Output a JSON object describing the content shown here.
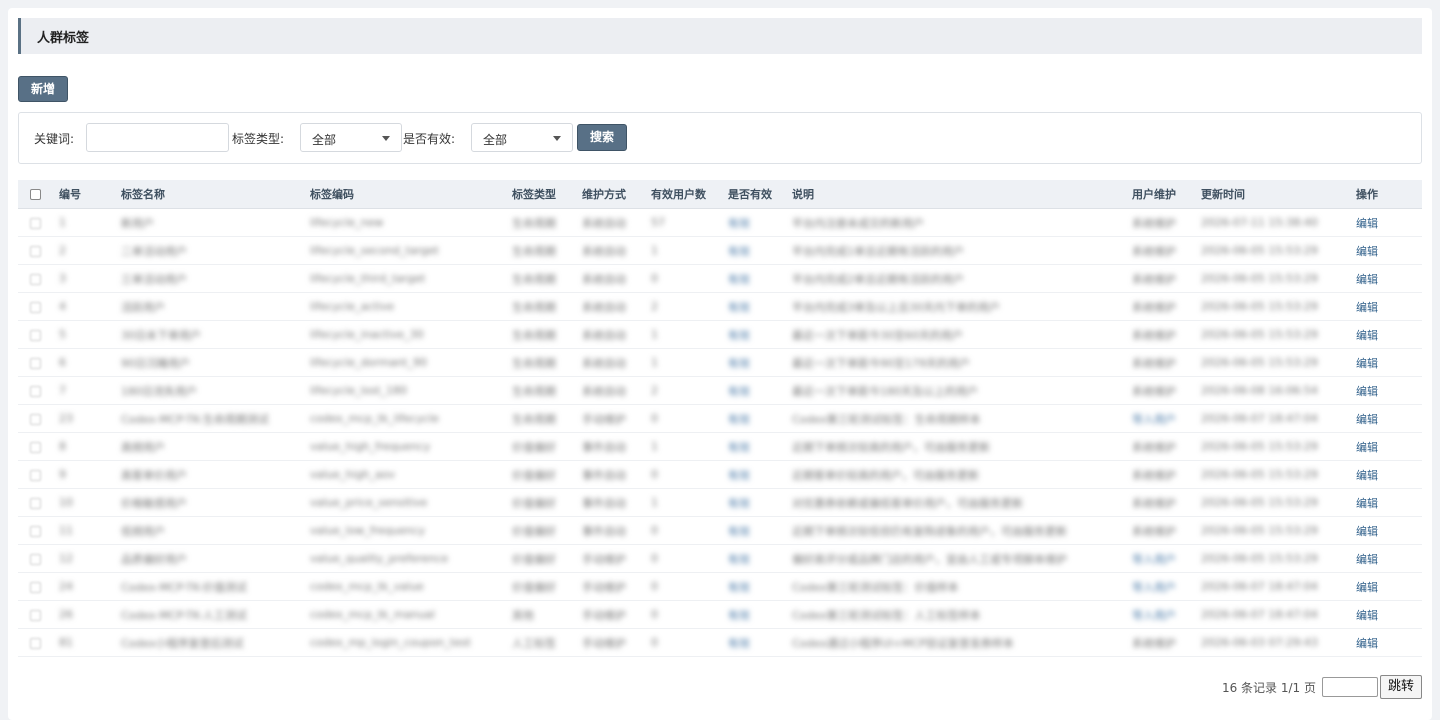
{
  "header": {
    "title": "人群标签"
  },
  "toolbar": {
    "add_label": "新增"
  },
  "search": {
    "keyword_label": "关键词:",
    "keyword_value": "",
    "type_label": "标签类型:",
    "type_value": "全部",
    "valid_label": "是否有效:",
    "valid_value": "全部",
    "search_label": "搜索"
  },
  "table": {
    "columns": [
      "编号",
      "标签名称",
      "标签编码",
      "标签类型",
      "维护方式",
      "有效用户数",
      "是否有效",
      "说明",
      "用户维护",
      "更新时间",
      "操作"
    ],
    "rows": [
      [
        "1",
        "新用户",
        "lifecycle_new",
        "生命周期",
        "系统自动",
        "57",
        "有效",
        "平台内注册未成交的新用户",
        "系统维护",
        "2026-07-11 15:38:40",
        "编辑"
      ],
      [
        "2",
        "二单活动用户",
        "lifecycle_second_target",
        "生命周期",
        "系统自动",
        "1",
        "有效",
        "平台内完成1单且近期有活跃的用户",
        "系统维护",
        "2026-06-05 15:53:29",
        "编辑"
      ],
      [
        "3",
        "三单活动用户",
        "lifecycle_third_target",
        "生命周期",
        "系统自动",
        "0",
        "有效",
        "平台内完成2单且近期有活跃的用户",
        "系统维护",
        "2026-06-05 15:53:29",
        "编辑"
      ],
      [
        "4",
        "活跃用户",
        "lifecycle_active",
        "生命周期",
        "系统自动",
        "2",
        "有效",
        "平台内完成3单及以上且30天内下单的用户",
        "系统维护",
        "2026-06-05 15:53:29",
        "编辑"
      ],
      [
        "5",
        "30日未下单用户",
        "lifecycle_inactive_30",
        "生命周期",
        "系统自动",
        "1",
        "有效",
        "最近一次下单距今30至60天的用户",
        "系统维护",
        "2026-06-05 15:53:29",
        "编辑"
      ],
      [
        "6",
        "90日沉睡用户",
        "lifecycle_dormant_90",
        "生命周期",
        "系统自动",
        "1",
        "有效",
        "最近一次下单距今90至179天的用户",
        "系统维护",
        "2026-06-05 15:53:29",
        "编辑"
      ],
      [
        "7",
        "180日流失用户",
        "lifecycle_lost_180",
        "生命周期",
        "系统自动",
        "2",
        "有效",
        "最近一次下单距今180天及以上的用户",
        "系统维护",
        "2026-06-08 16:06:54",
        "编辑"
      ],
      [
        "23",
        "Codex-MCP-TK-生命周期测试",
        "codex_mcp_tk_lifecycle",
        "生命周期",
        "手动维护",
        "0",
        "有效",
        "Codex第三轮测试标签：生命周期样本",
        "导入用户",
        "2026-06-07 18:47:04",
        "编辑"
      ],
      [
        "8",
        "高频用户",
        "value_high_frequency",
        "价值偏好",
        "事件自动",
        "1",
        "有效",
        "近期下单频次较高的用户，可由服务更新",
        "系统维护",
        "2026-06-05 15:53:29",
        "编辑"
      ],
      [
        "9",
        "高客单价用户",
        "value_high_aov",
        "价值偏好",
        "事件自动",
        "0",
        "有效",
        "近期客单价较高的用户，可由服务更新",
        "系统维护",
        "2026-06-05 15:53:29",
        "编辑"
      ],
      [
        "10",
        "价格敏感用户",
        "value_price_sensitive",
        "价值偏好",
        "事件自动",
        "1",
        "有效",
        "对优惠券依赖或偏低客单价用户，可由服务更新",
        "系统维护",
        "2026-06-05 15:53:29",
        "编辑"
      ],
      [
        "11",
        "低频用户",
        "value_low_frequency",
        "价值偏好",
        "事件自动",
        "0",
        "有效",
        "近期下单频次较低但仍有复购迹象的用户，可由服务更新",
        "系统维护",
        "2026-06-05 15:53:29",
        "编辑"
      ],
      [
        "12",
        "品质偏好用户",
        "value_quality_preference",
        "价值偏好",
        "手动维护",
        "0",
        "有效",
        "偏好高评分或品牌门店的用户，宜由人工或专项脚本维护",
        "导入用户",
        "2026-06-05 15:53:29",
        "编辑"
      ],
      [
        "24",
        "Codex-MCP-TK-价值测试",
        "codex_mcp_tk_value",
        "价值偏好",
        "手动维护",
        "0",
        "有效",
        "Codex第三轮测试标签：价值样本",
        "导入用户",
        "2026-06-07 18:47:04",
        "编辑"
      ],
      [
        "26",
        "Codex-MCP-TK-人工测试",
        "codex_mcp_tk_manual",
        "其他",
        "手动维护",
        "0",
        "有效",
        "Codex第三轮测试标签：人工标签样本",
        "导入用户",
        "2026-06-07 18:47:04",
        "编辑"
      ],
      [
        "81",
        "Codex小程序复登后测试",
        "codex_mp_login_coupon_test",
        "人工标签",
        "手动维护",
        "0",
        "有效",
        "Codex通过小程序UI+MCP验证复登发券样本",
        "系统维护",
        "2026-06-03 07:29:43",
        "编辑"
      ]
    ]
  },
  "pager": {
    "summary": "16 条记录 1/1 页",
    "jump_label": "跳转"
  }
}
